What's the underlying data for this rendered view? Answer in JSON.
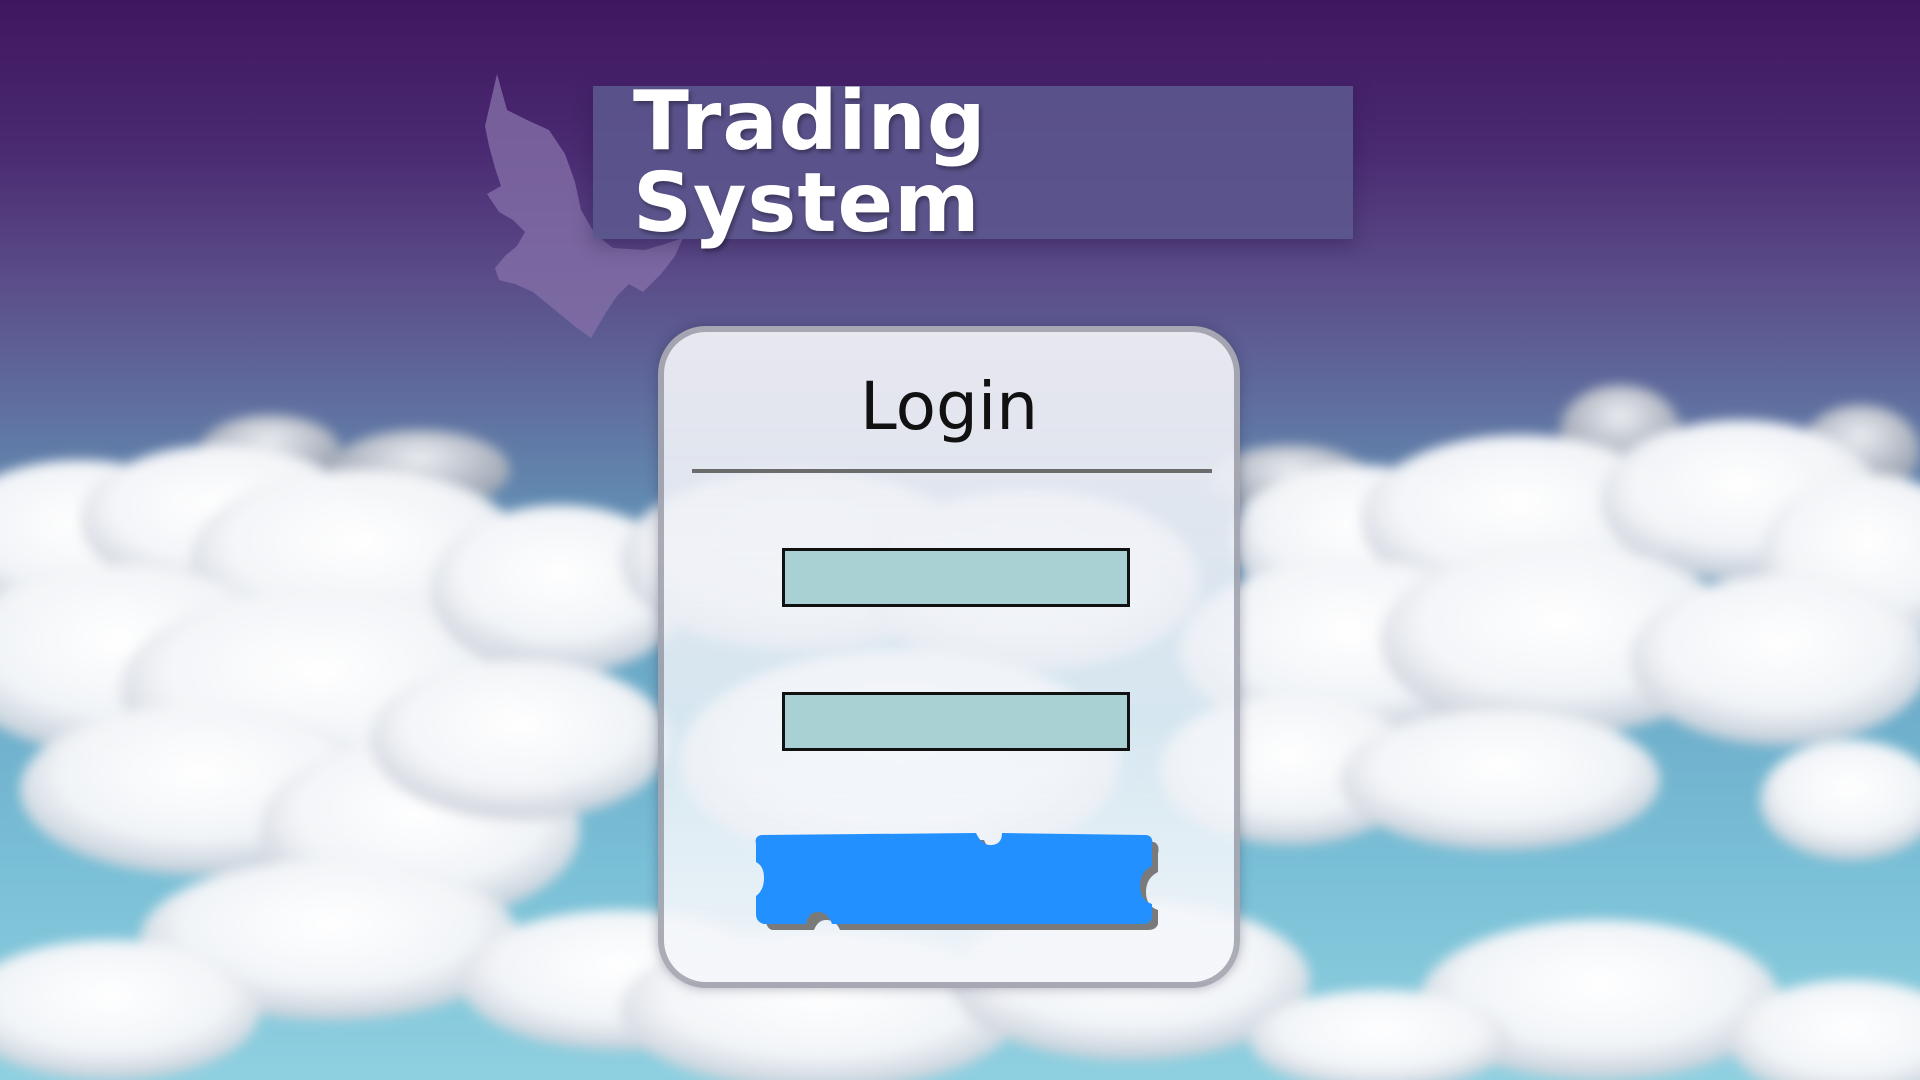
{
  "header": {
    "title": "Trading System",
    "logo_icon": "unicorn-icon"
  },
  "login": {
    "heading": "Login",
    "username_value": "",
    "password_value": "",
    "button_label": ""
  },
  "colors": {
    "sky_top": "#3f1660",
    "sky_bottom": "#8fd0e0",
    "banner": "#5c588e",
    "field_fill": "#a9d0d2",
    "button": "#2290ff",
    "button_shadow": "#7a7a7a"
  }
}
